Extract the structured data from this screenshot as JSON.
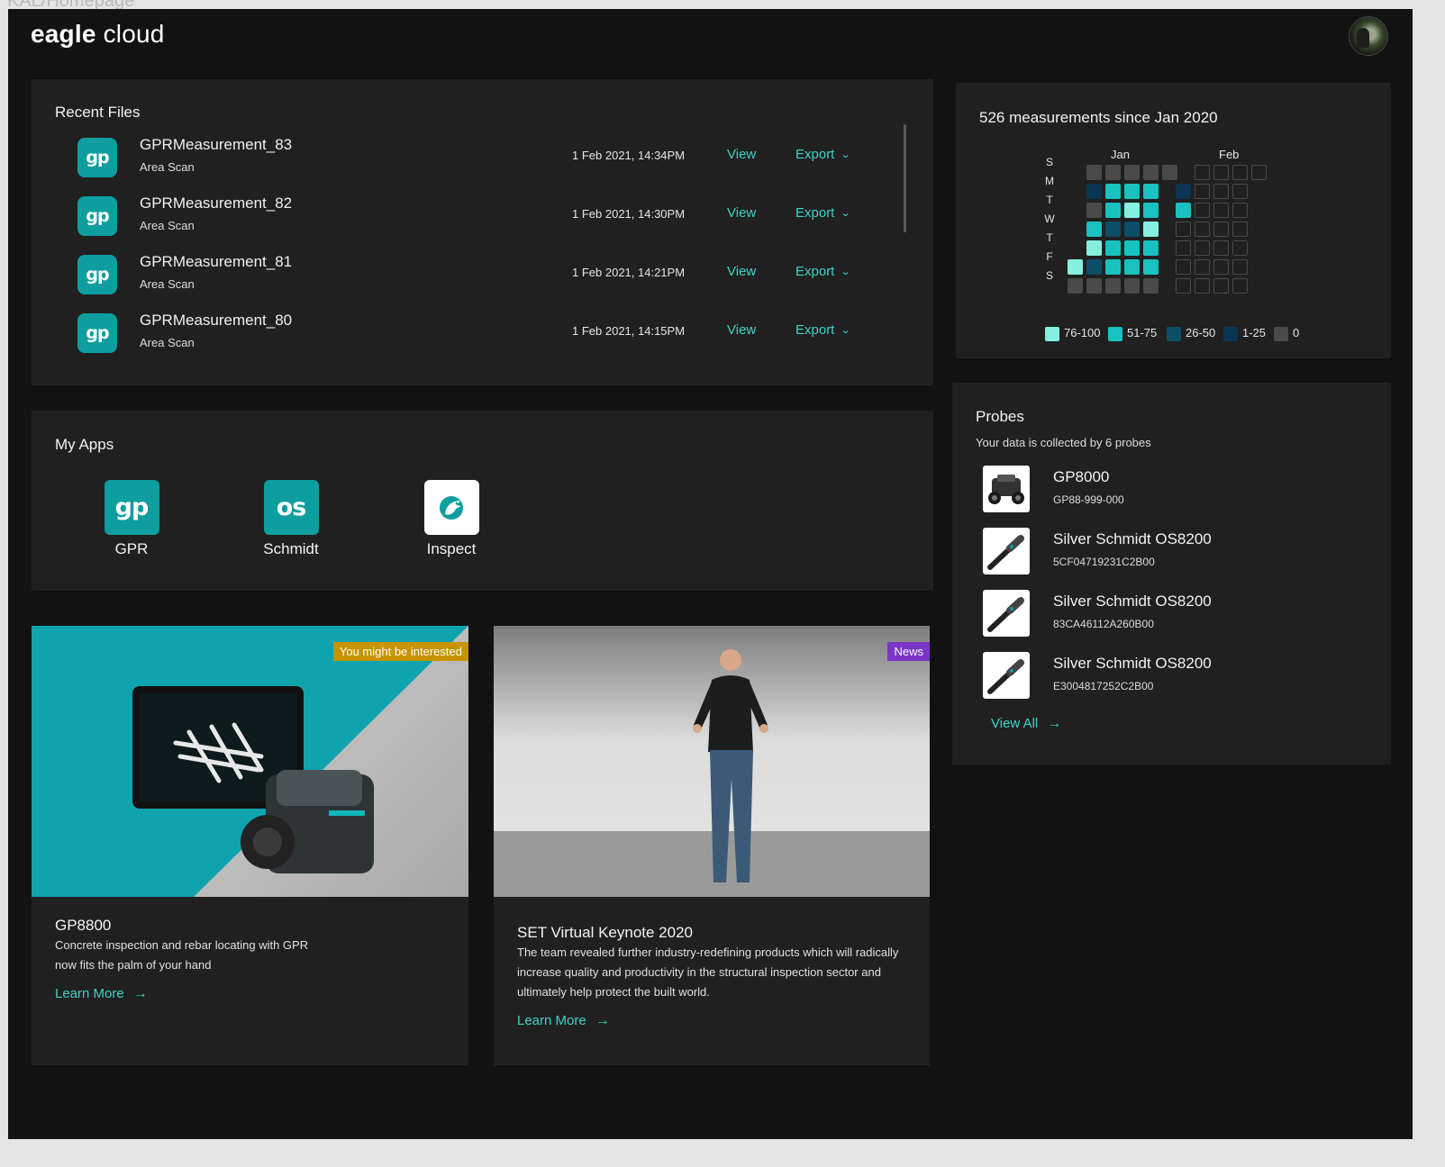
{
  "frame_label": "KAL/Homepage",
  "header": {
    "logo_bold": "eagle",
    "logo_light": "cloud"
  },
  "recent_files": {
    "title": "Recent Files",
    "view_label": "View",
    "export_label": "Export",
    "icon_text": "gp",
    "rows": [
      {
        "name": "GPRMeasurement_83",
        "type": "Area Scan",
        "date": "1 Feb 2021, 14:34PM"
      },
      {
        "name": "GPRMeasurement_82",
        "type": "Area Scan",
        "date": "1 Feb 2021, 14:30PM"
      },
      {
        "name": "GPRMeasurement_81",
        "type": "Area Scan",
        "date": "1 Feb 2021, 14:21PM"
      },
      {
        "name": "GPRMeasurement_80",
        "type": "Area Scan",
        "date": "1 Feb 2021, 14:15PM"
      }
    ]
  },
  "my_apps": {
    "title": "My Apps",
    "apps": [
      {
        "label": "GPR",
        "icon_text": "gp",
        "icon": "gpr-app-icon"
      },
      {
        "label": "Schmidt",
        "icon_text": "os",
        "icon": "schmidt-app-icon"
      },
      {
        "label": "Inspect",
        "icon_text": "",
        "icon": "eagle-icon"
      }
    ]
  },
  "cards": [
    {
      "badge": "You might be interested",
      "title": "GP8800",
      "text": "Concrete inspection and rebar locating with GPR now fits the palm of your hand",
      "link": "Learn More",
      "badge_color": "#c69400"
    },
    {
      "badge": "News",
      "title": "SET Virtual Keynote 2020",
      "text": "The team revealed further industry-redefining products which will radically increase quality and productivity in the structural inspection sector and ultimately help protect the built world.",
      "link": "Learn More",
      "badge_color": "#7a34c6"
    }
  ],
  "heatmap": {
    "title": "526 measurements since Jan 2020",
    "months": [
      "Jan",
      "Feb"
    ],
    "days": [
      "S",
      "M",
      "T",
      "W",
      "T",
      "F",
      "S"
    ],
    "legend": [
      "76-100",
      "51-75",
      "26-50",
      "1-25",
      "0"
    ],
    "colors": {
      "76-100": "#86f0e0",
      "51-75": "#19c1c0",
      "26-50": "#0c4d68",
      "1-25": "#0c3552",
      "0": "#4a4a4a"
    },
    "weeks": [
      [
        "-",
        "-",
        "-",
        "-",
        "-",
        "4",
        "0"
      ],
      [
        "0",
        "1",
        "0",
        "3",
        "4",
        "2",
        "0"
      ],
      [
        "0",
        "3",
        "3",
        "2",
        "3",
        "3",
        "0"
      ],
      [
        "0",
        "3",
        "4",
        "2",
        "3",
        "3",
        "0"
      ],
      [
        "0",
        "3",
        "3",
        "4",
        "3",
        "3",
        "0"
      ],
      [
        "0",
        "-",
        "-",
        "-",
        "-",
        "-",
        "-"
      ],
      [
        "-",
        "1",
        "3",
        "e",
        "e",
        "e",
        "e"
      ],
      [
        "e",
        "e",
        "e",
        "e",
        "e",
        "e",
        "e"
      ],
      [
        "e",
        "e",
        "e",
        "e",
        "e",
        "e",
        "e"
      ],
      [
        "e",
        "e",
        "e",
        "e",
        "e",
        "e",
        "e"
      ],
      [
        "e",
        "-",
        "-",
        "-",
        "-",
        "-",
        "-"
      ]
    ]
  },
  "probes": {
    "title": "Probes",
    "subtitle": "Your data is collected by 6 probes",
    "items": [
      {
        "name": "GP8000",
        "serial": "GP88-999-000",
        "kind": "gpr"
      },
      {
        "name": "Silver Schmidt OS8200",
        "serial": "5CF04719231C2B00",
        "kind": "hammer"
      },
      {
        "name": "Silver Schmidt OS8200",
        "serial": "83CA46112A260B00",
        "kind": "hammer"
      },
      {
        "name": "Silver Schmidt OS8200",
        "serial": "E3004817252C2B00",
        "kind": "hammer"
      }
    ],
    "view_all": "View All"
  }
}
